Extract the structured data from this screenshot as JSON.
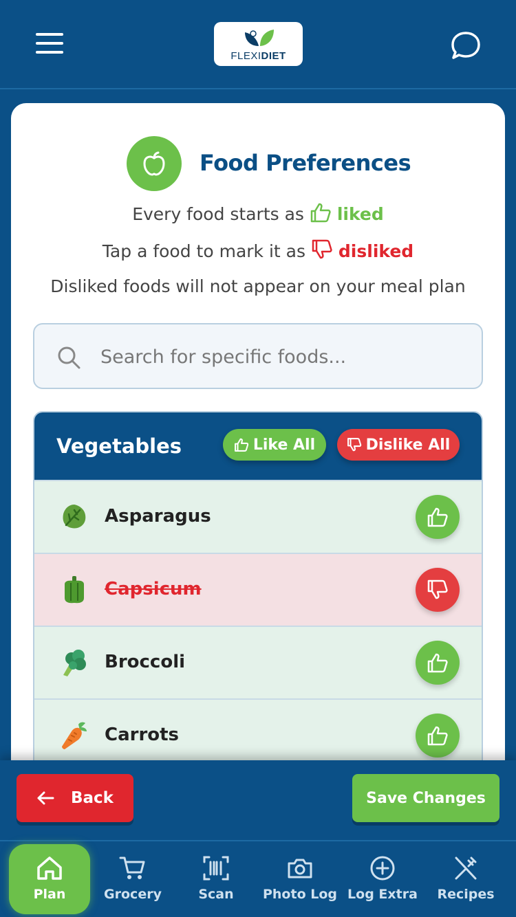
{
  "header": {
    "logo_text_light": "FLEXI",
    "logo_text_bold": "DIET",
    "menu_icon": "hamburger-menu-icon",
    "chat_icon": "chat-bubble-icon"
  },
  "intro": {
    "title": "Food Preferences",
    "line1_prefix": "Every food starts as",
    "line1_state": "liked",
    "line2_prefix": "Tap a food to mark it as",
    "line2_state": "disliked",
    "line3": "Disliked foods will not appear on your meal plan"
  },
  "search": {
    "placeholder": "Search for specific foods...",
    "value": ""
  },
  "category": {
    "title": "Vegetables",
    "like_all_label": "Like All",
    "dislike_all_label": "Dislike All",
    "items": [
      {
        "name": "Asparagus",
        "state": "liked",
        "icon": "leafy-vegetable-icon"
      },
      {
        "name": "Capsicum",
        "state": "disliked",
        "icon": "bell-pepper-icon"
      },
      {
        "name": "Broccoli",
        "state": "liked",
        "icon": "broccoli-icon"
      },
      {
        "name": "Carrots",
        "state": "liked",
        "icon": "carrot-icon"
      }
    ]
  },
  "actions": {
    "back_label": "Back",
    "save_label": "Save Changes"
  },
  "tabs": [
    {
      "label": "Plan",
      "icon": "home-icon",
      "active": true
    },
    {
      "label": "Grocery",
      "icon": "cart-icon",
      "active": false
    },
    {
      "label": "Scan",
      "icon": "barcode-scan-icon",
      "active": false
    },
    {
      "label": "Photo Log",
      "icon": "camera-icon",
      "active": false
    },
    {
      "label": "Log Extra",
      "icon": "plus-circle-icon",
      "active": false
    },
    {
      "label": "Recipes",
      "icon": "fork-knife-icon",
      "active": false
    }
  ],
  "colors": {
    "primary": "#0b5087",
    "liked": "#6cc04a",
    "disliked": "#e0262e"
  }
}
